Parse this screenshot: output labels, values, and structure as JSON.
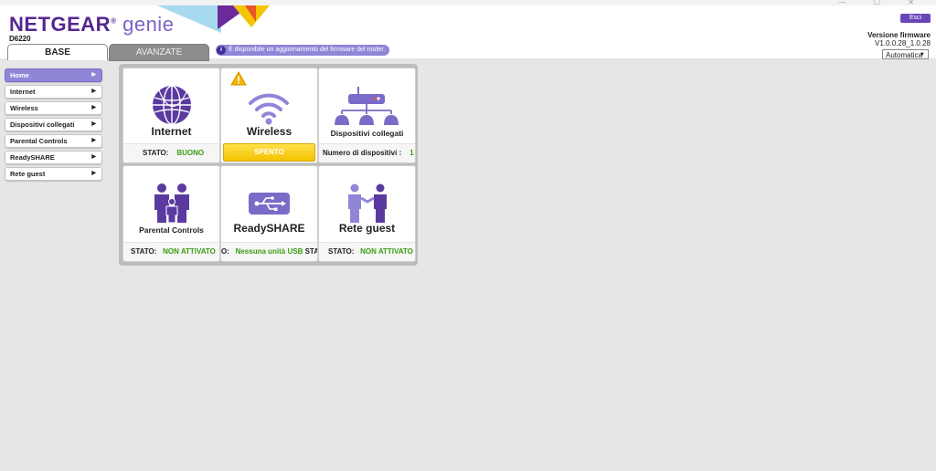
{
  "header": {
    "brand": "NETGEAR",
    "brand_suffix": "genie",
    "trademark": "®",
    "model": "D6220",
    "tabs": [
      {
        "label": "BASE"
      },
      {
        "label": "AVANZATE"
      }
    ],
    "notice": "È disponibile un aggiornamento del firmware del router.",
    "notice_icon": "i",
    "logout_label": "Esci",
    "firmware_label": "Versione firmware",
    "firmware_version": "V1.0.0.28_1.0.28",
    "language_selected": "Automatica"
  },
  "sidebar": {
    "items": [
      {
        "label": "Home"
      },
      {
        "label": "Internet"
      },
      {
        "label": "Wireless"
      },
      {
        "label": "Dispositivi collegati"
      },
      {
        "label": "Parental Controls"
      },
      {
        "label": "ReadySHARE"
      },
      {
        "label": "Rete guest"
      }
    ]
  },
  "tiles": {
    "internet": {
      "title": "Internet",
      "status_label": "STATO:",
      "status_value": "BUONO"
    },
    "wireless": {
      "title": "Wireless",
      "status_value": "SPENTO"
    },
    "devices": {
      "title": "Dispositivi collegati",
      "status_label": "Numero di dispositivi :",
      "status_value": "1"
    },
    "parental": {
      "title": "Parental Controls",
      "status_label": "STATO:",
      "status_value": "NON ATTIVATO"
    },
    "readyshare": {
      "title": "ReadySHARE",
      "status_label": "O:",
      "status_value": "Nessuna unità USB",
      "status_tail": "STAT"
    },
    "guest": {
      "title": "Rete guest",
      "status_label": "STATO:",
      "status_value": "NON ATTIVATO"
    }
  },
  "colors": {
    "brand_purple": "#55278f",
    "accent_lavender": "#8f86d8",
    "status_green": "#3a9d13",
    "warning_yellow": "#f4c200"
  }
}
